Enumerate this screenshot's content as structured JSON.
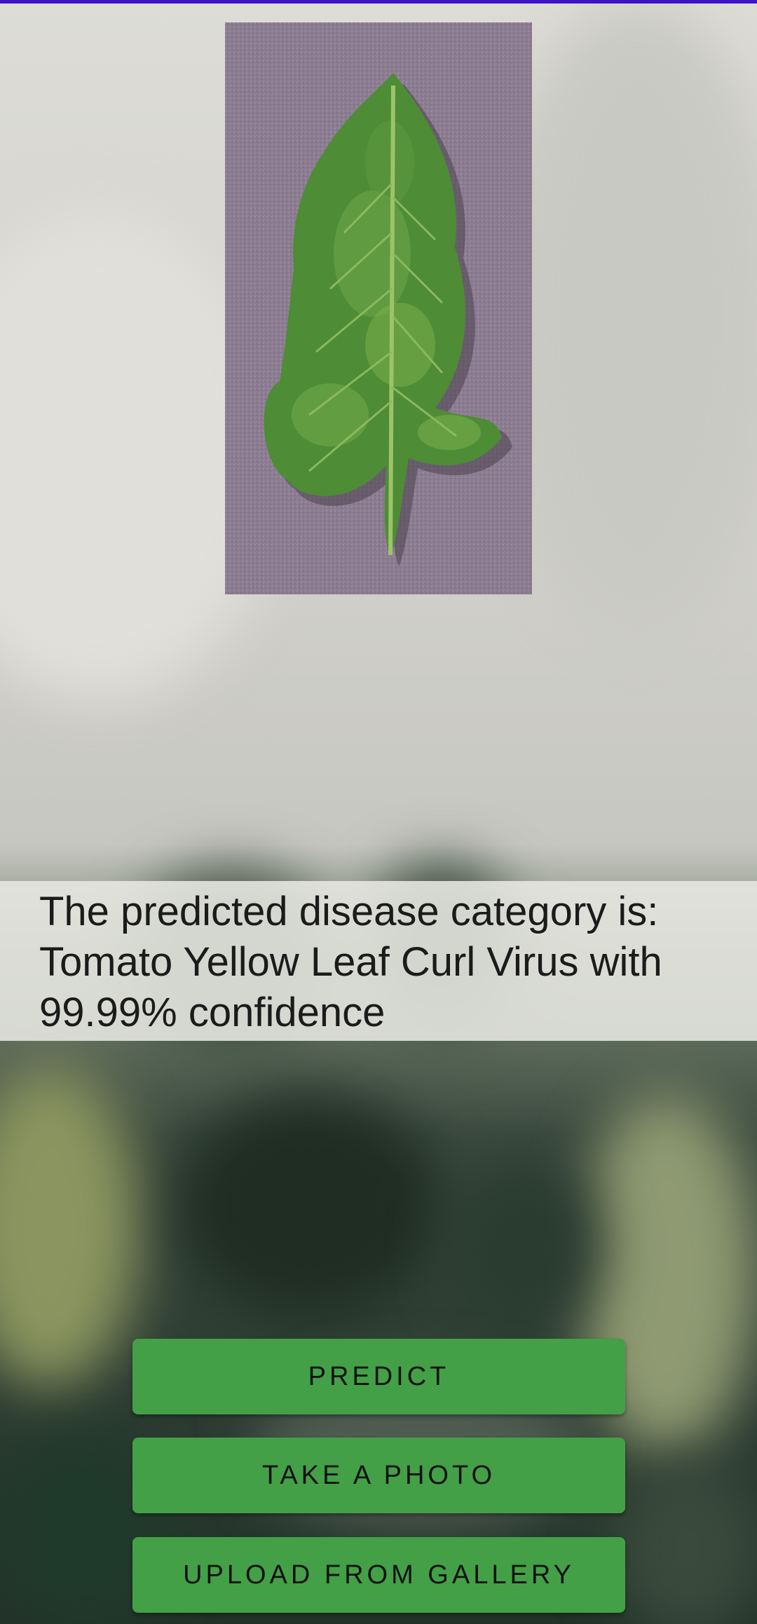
{
  "result": {
    "text": "The predicted disease category is: Tomato Yellow Leaf Curl Virus with 99.99% confidence"
  },
  "buttons": {
    "predict": "PREDICT",
    "take_photo": "TAKE A PHOTO",
    "upload_gallery": "UPLOAD FROM GALLERY"
  },
  "colors": {
    "status_bar": "#3b13c9",
    "button": "#43a047",
    "photo_backdrop": "#8d7d92",
    "leaf": "#4f8f3a"
  },
  "image": {
    "subject": "tomato leaf on purple background"
  }
}
